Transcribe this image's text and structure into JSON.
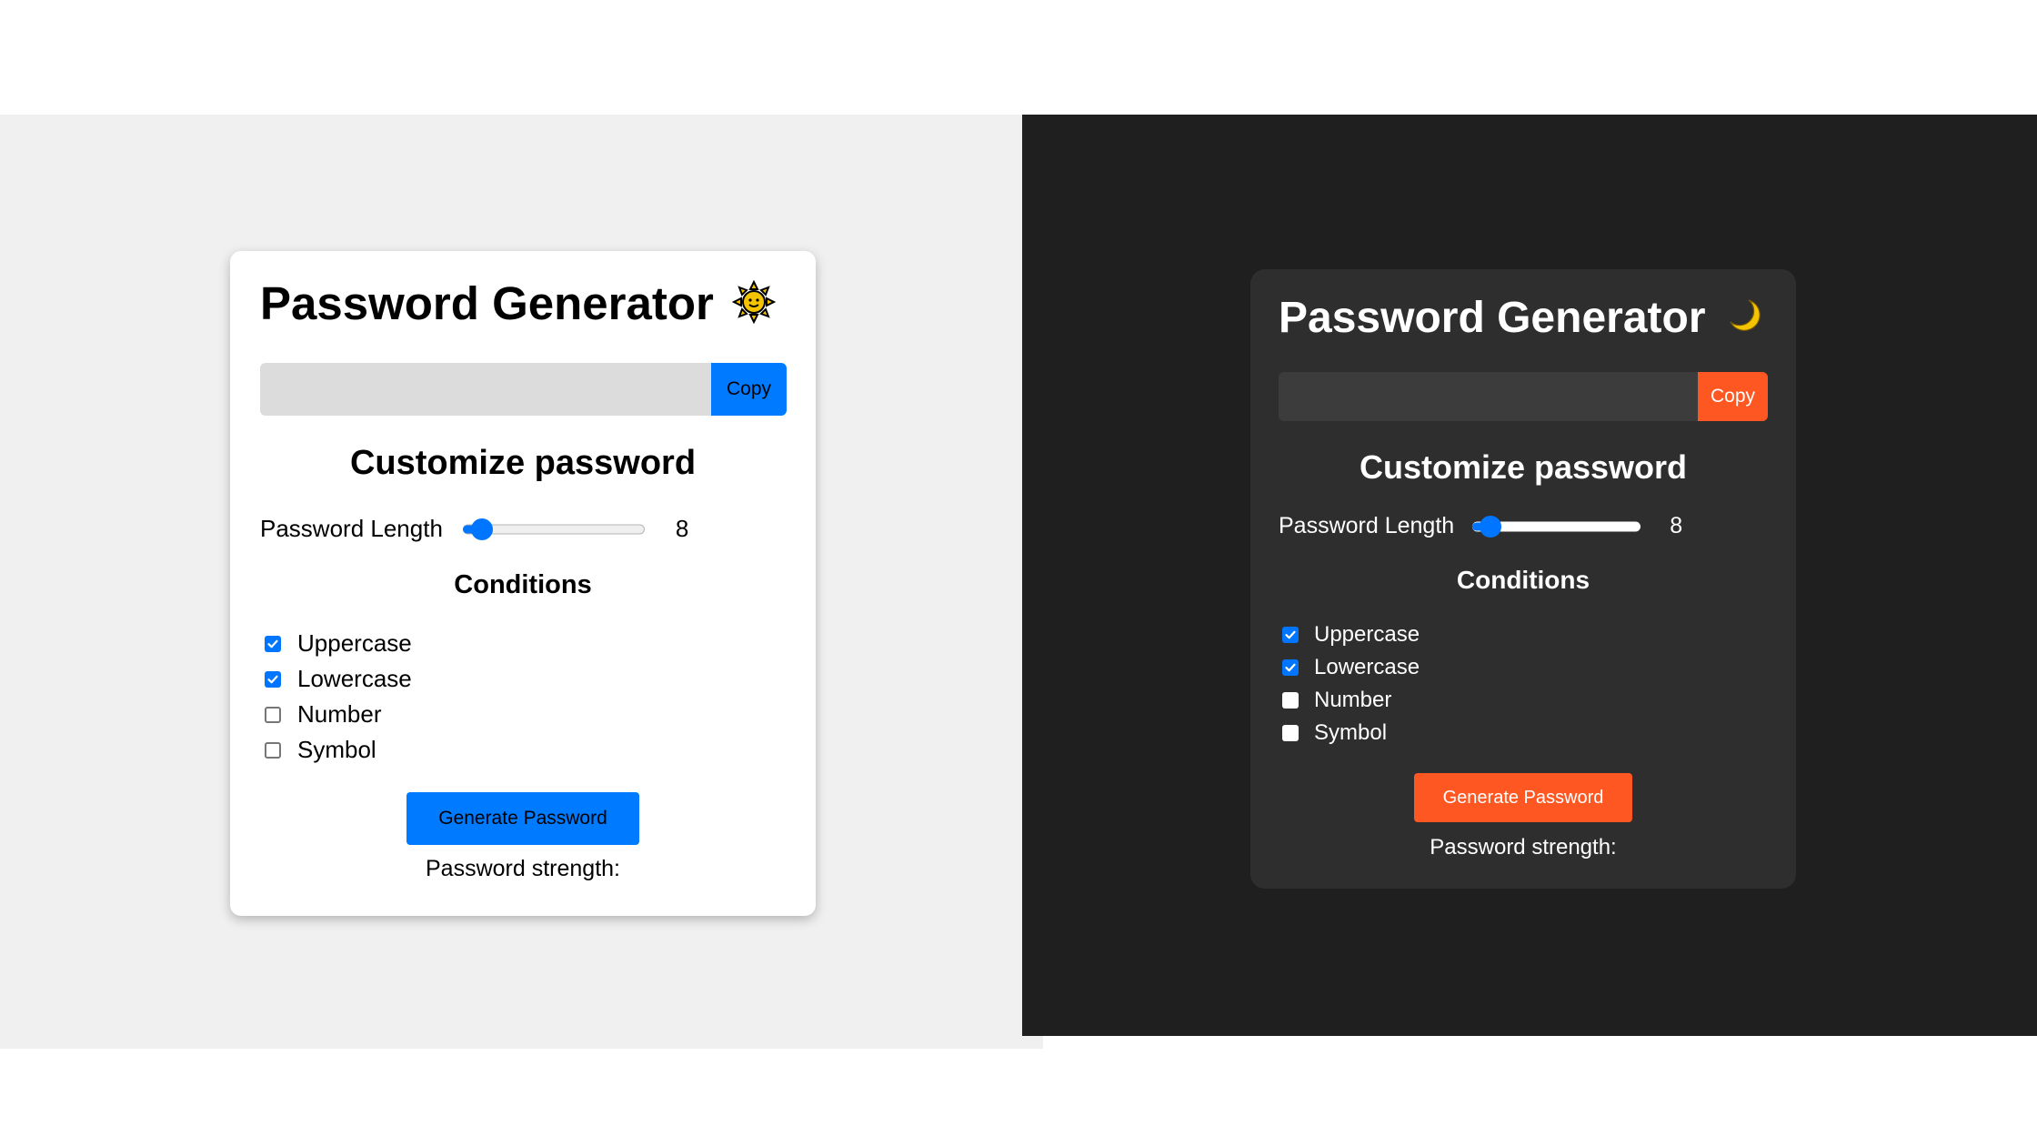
{
  "light": {
    "title": "Password Generator",
    "theme_icon": "sun-icon",
    "password_value": "",
    "copy_label": "Copy",
    "customize_heading": "Customize password",
    "length_label": "Password Length",
    "length_value": "8",
    "length_slider_fraction": 0.05,
    "conditions_heading": "Conditions",
    "conditions": [
      {
        "label": "Uppercase",
        "checked": true
      },
      {
        "label": "Lowercase",
        "checked": true
      },
      {
        "label": "Number",
        "checked": false
      },
      {
        "label": "Symbol",
        "checked": false
      }
    ],
    "generate_label": "Generate Password",
    "strength_label": "Password strength:"
  },
  "dark": {
    "title": "Password Generator",
    "theme_icon": "moon-icon",
    "password_value": "",
    "copy_label": "Copy",
    "customize_heading": "Customize password",
    "length_label": "Password Length",
    "length_value": "8",
    "length_slider_fraction": 0.05,
    "conditions_heading": "Conditions",
    "conditions": [
      {
        "label": "Uppercase",
        "checked": true
      },
      {
        "label": "Lowercase",
        "checked": true
      },
      {
        "label": "Number",
        "checked": false
      },
      {
        "label": "Symbol",
        "checked": false
      }
    ],
    "generate_label": "Generate Password",
    "strength_label": "Password strength:"
  },
  "colors": {
    "light_accent": "#007bff",
    "dark_accent": "#ff5722",
    "checkbox_checked": "#0075ff",
    "light_background": "#f0f0f0",
    "dark_background": "#1f1f1f"
  }
}
